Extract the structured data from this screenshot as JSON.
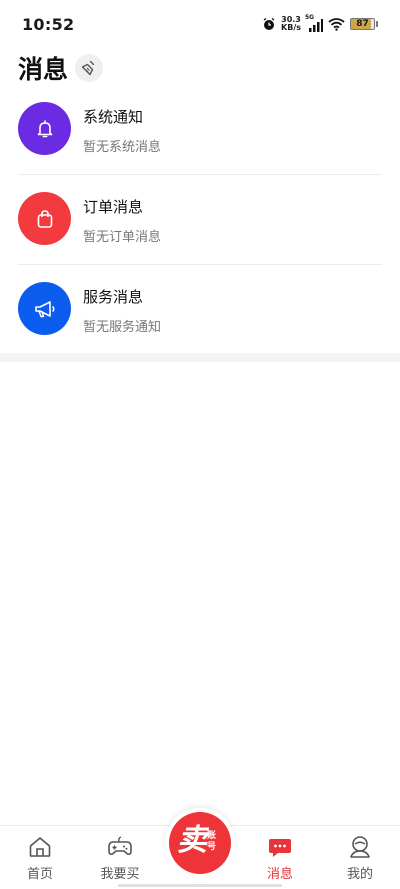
{
  "status_bar": {
    "time": "10:52",
    "net_speed_value": "30.3",
    "net_speed_unit": "KB/s",
    "network": "5G",
    "battery": "87",
    "battery_level": 0.87
  },
  "header": {
    "title": "消息",
    "clear_icon": "broom-icon"
  },
  "messages": [
    {
      "title": "系统通知",
      "subtitle": "暂无系统消息",
      "icon": "bell-icon",
      "color": "#6a2be3"
    },
    {
      "title": "订单消息",
      "subtitle": "暂无订单消息",
      "icon": "bag-icon",
      "color": "#f23a3f"
    },
    {
      "title": "服务消息",
      "subtitle": "暂无服务通知",
      "icon": "megaphone-icon",
      "color": "#0d5cf0"
    }
  ],
  "tabbar": {
    "tabs": [
      {
        "label": "首页",
        "icon": "home-icon",
        "active": false
      },
      {
        "label": "我要买",
        "icon": "gamepad-icon",
        "active": false
      },
      {
        "label": "消息",
        "icon": "chat-icon",
        "active": true
      },
      {
        "label": "我的",
        "icon": "profile-icon",
        "active": false
      }
    ],
    "sell": {
      "main": "卖",
      "sub": "账号"
    },
    "active_color": "#e8353b"
  }
}
